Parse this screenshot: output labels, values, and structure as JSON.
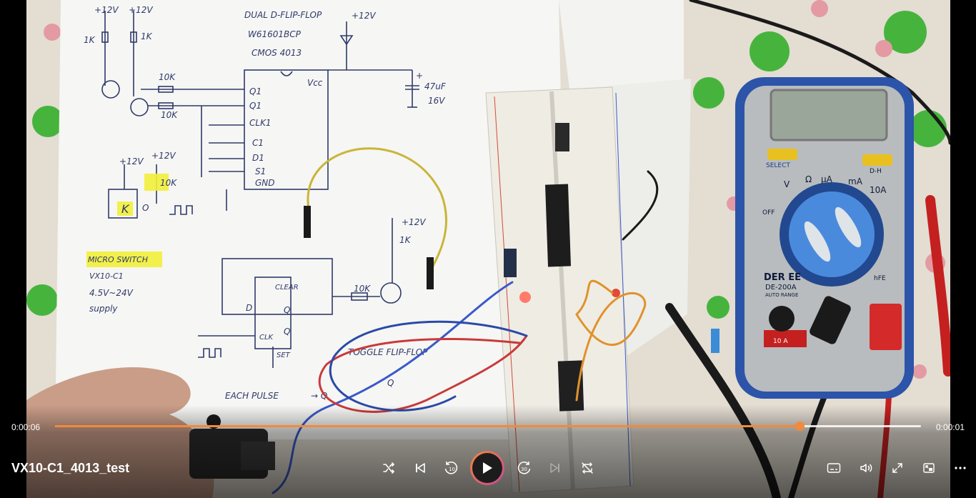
{
  "player": {
    "title": "VX10-C1_4013_test",
    "time_elapsed": "0:00:06",
    "time_remaining": "0:00:01",
    "progress": 0.86,
    "accent_color": "#f08a3c"
  },
  "video_text": {
    "schematic": {
      "plus12v": "+12V",
      "one_k": "1K",
      "ten_k": "10K",
      "title_lines": [
        "DUAL D-FLIP-FLOP",
        "W61601BCP",
        "CMOS 4013"
      ],
      "vcc": "Vcc",
      "pins": [
        "Q1",
        "Q1",
        "CLK1",
        "C1",
        "D1",
        "S1",
        "GND"
      ],
      "cap": [
        "+",
        "47uF",
        "16V"
      ],
      "relay_k": "K",
      "relay_o": "O",
      "ten_k_highlight": "10K",
      "micro_switch": [
        "MICRO SWITCH",
        "VX10-C1"
      ],
      "supply": [
        "4.5V~24V",
        "supply"
      ],
      "clear": "CLEAR",
      "d": "D",
      "q": "Q",
      "qbar": "Q",
      "clk": "CLK",
      "set": "SET",
      "toggle": "TOGGLE FLIP-FLOP",
      "each_pulse": "EACH PULSE",
      "arrow_q": "→ Q",
      "q2": "Q"
    },
    "multimeter": {
      "brand": "DER EE",
      "model": "DE-200A",
      "auto_range": "AUTO RANGE",
      "select": "SELECT",
      "dh": "D-H",
      "off": "OFF",
      "hfe": "hFE",
      "ten_a": "10A",
      "v": "V",
      "ohm": "Ω",
      "ua": "µA",
      "ma": "mA",
      "ten_a_fused": "10 A"
    }
  },
  "icons": {
    "shuffle": "shuffle-icon",
    "previous": "skip-previous-icon",
    "rewind10": "rewind-10-icon",
    "play": "play-icon",
    "forward30": "forward-30-icon",
    "next": "skip-next-icon",
    "repeat_off": "repeat-off-icon",
    "captions": "captions-icon",
    "volume": "volume-icon",
    "fullscreen": "fullscreen-icon",
    "miniplayer": "miniplayer-icon",
    "more": "more-options-icon"
  }
}
